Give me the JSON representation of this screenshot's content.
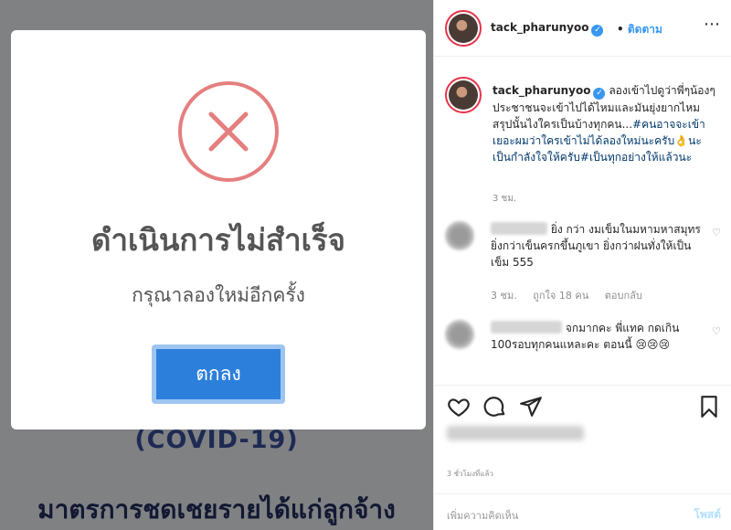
{
  "image_panel": {
    "dialog": {
      "title": "ดำเนินการไม่สำเร็จ",
      "subtitle": "กรุณาลองใหม่อีกครั้ง",
      "ok_button": "ตกลง",
      "icon": "error-x-circle-icon",
      "icon_color": "#e57f7f"
    },
    "background_text": {
      "covid": "(COVID-19)",
      "measure": "มาตรการชดเชยรายได้แก่ลูกจ้าง"
    }
  },
  "post": {
    "header": {
      "username": "tack_pharunyoo",
      "separator": "•",
      "follow_label": "ติดตาม",
      "more_icon": "more-horizontal-icon"
    },
    "caption": {
      "username": "tack_pharunyoo",
      "text": "ลองเข้าไปดูว่าพี่ๆน้องๆประชาชนจะเข้าไปได้ไหมและมันยุ่งยากไหม สรุปนั้นไงใครเป็นบ้างทุกคน...",
      "hashtag1": "#คนอาจจะเข้าเยอะผมว่าใครเข้าไม่ได้ลองใหม่นะครับ",
      "emoji": "👌",
      "hashtag1_tail": "นะเป็นกำลังใจให้ครับ",
      "hashtag2": "#เป็นทุกอย่างให้แล้วนะ",
      "time": "3 ชม."
    },
    "comments": [
      {
        "text": "ยิ่ง กว่า งมเข็มในมหามหาสมุทร ยิ่งกว่าเข็นครกขึ้นภูเขา ยิ่งกว่าฝนทั่งให้เป็นเข็ม 555",
        "time": "3 ชม.",
        "likes": "ถูกใจ 18 คน",
        "reply": "ตอบกลับ"
      },
      {
        "text": "จกมากคะ พี่แทค กดเกิน 100รอบทุกคนแหละคะ ตอนนี้",
        "emojis": "😢😢😢"
      }
    ],
    "post_time": "3 ชั่วโมงที่แล้ว",
    "add_comment": {
      "placeholder": "เพิ่มความคิดเห็น",
      "post_label": "โพสต์"
    },
    "colors": {
      "link_blue": "#3897f0",
      "hashtag": "#00376b"
    }
  }
}
